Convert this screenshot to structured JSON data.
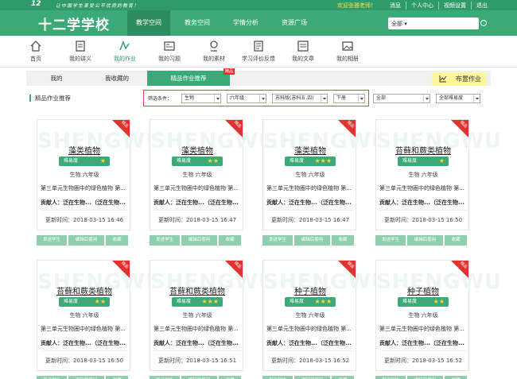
{
  "topbar": {
    "logo": "12",
    "slogan": "让中国学生享受公平优质的教育！",
    "welcome": "欢迎张雅老师！",
    "links": [
      "消息",
      "个人中心",
      "视频设置",
      "退出"
    ]
  },
  "header": {
    "school": "十二学学校",
    "nav": [
      "教学空间",
      "教务空间",
      "学情分析",
      "资源广场"
    ],
    "search_scope": "全部"
  },
  "iconnav": [
    {
      "label": "首页",
      "icon": "home-icon"
    },
    {
      "label": "我的讲义",
      "icon": "lecture-notes-icon"
    },
    {
      "label": "我的作业",
      "icon": "homework-icon"
    },
    {
      "label": "我的习题",
      "icon": "exercise-icon"
    },
    {
      "label": "我的素材",
      "icon": "material-icon"
    },
    {
      "label": "学习评价反馈",
      "icon": "feedback-icon"
    },
    {
      "label": "我的文章",
      "icon": "article-icon"
    },
    {
      "label": "我的相册",
      "icon": "photo-album-icon"
    }
  ],
  "tabs": {
    "items": [
      "我的",
      "我收藏的",
      "精品作业推荐"
    ],
    "badge": "精品",
    "publish": "布置作业"
  },
  "section": {
    "title": "精品作业推荐"
  },
  "filter": {
    "label": "筛选条件：",
    "subject": "生物",
    "grade": "六年级",
    "edition": "苏科版(苏科五.四)",
    "volume": "下册",
    "all": "全部",
    "difficulty": "全部难易度"
  },
  "colors": {
    "brand": "#3caa76",
    "brand_dark": "#2f9a6a",
    "accent_red": "#e0322f",
    "star": "#ffd23c"
  },
  "card_labels": {
    "corner": "精品",
    "watermark": "SHENGWU",
    "difficulty_label": "难易度",
    "actions": [
      "发送学生",
      "编辑后使用",
      "收藏"
    ]
  },
  "cards": [
    {
      "title": "藻类植物",
      "stars": "★",
      "meta": "生物  六年级",
      "desc": "第三单元生物圈中的绿色植物  第...",
      "contributor": "贡献人：泛在生物...（泛在生物...",
      "updated": "更新时间：2018-03-15 16:46"
    },
    {
      "title": "藻类植物",
      "stars": "★★",
      "meta": "生物  六年级",
      "desc": "第三单元生物圈中的绿色植物  第...",
      "contributor": "贡献人：泛在生物...（泛在生物...",
      "updated": "更新时间：2018-03-15 16:47"
    },
    {
      "title": "藻类植物",
      "stars": "★★★",
      "meta": "生物  六年级",
      "desc": "第三单元生物圈中的绿色植物  第...",
      "contributor": "贡献人：泛在生物...（泛在生物...",
      "updated": "更新时间：2018-03-15 16:47"
    },
    {
      "title": "苔藓和蕨类植物",
      "stars": "★",
      "meta": "生物  六年级",
      "desc": "第三单元生物圈中的绿色植物  第...",
      "contributor": "贡献人：泛在生物...（泛在生物...",
      "updated": "更新时间：2018-03-15 16:50"
    },
    {
      "title": "苔藓和蕨类植物",
      "stars": "★★",
      "meta": "生物  六年级",
      "desc": "第三单元生物圈中的绿色植物  第...",
      "contributor": "贡献人：泛在生物...（泛在生物...",
      "updated": "更新时间：2018-03-15 16:50"
    },
    {
      "title": "苔藓和蕨类植物",
      "stars": "★★★",
      "meta": "生物  六年级",
      "desc": "第三单元生物圈中的绿色植物  第...",
      "contributor": "贡献人：泛在生物...（泛在生物...",
      "updated": "更新时间：2018-03-15 16:51"
    },
    {
      "title": "种子植物",
      "stars": "★★★",
      "meta": "生物  六年级",
      "desc": "第三单元生物圈中的绿色植物  第...",
      "contributor": "贡献人：泛在生物...（泛在生物...",
      "updated": "更新时间：2018-03-15 16:52"
    },
    {
      "title": "种子植物",
      "stars": "★★",
      "meta": "生物  六年级",
      "desc": "第三单元生物圈中的绿色植物  第...",
      "contributor": "贡献人：泛在生物...（泛在生物...",
      "updated": "更新时间：2018-03-15 16:52"
    }
  ]
}
